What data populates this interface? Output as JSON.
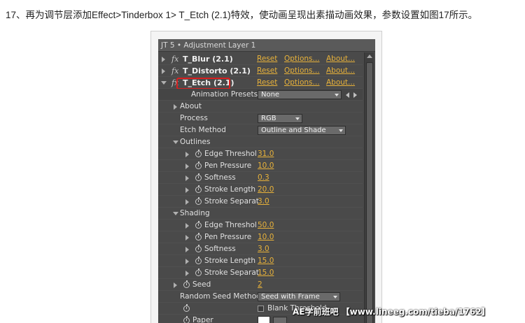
{
  "caption": "17、再为调节层添加Effect>Tinderbox 1> T_Etch (2.1)特效，使动画呈现出素描动画效果，参数设置如图17所示。",
  "panel": {
    "title": "JT 5 • Adjustment Layer 1",
    "fx_glyph": "fx",
    "effects": [
      {
        "name": "T_Blur (2.1)",
        "reset": "Reset",
        "options": "Options...",
        "about": "About..."
      },
      {
        "name": "T_Distorto (2.1)",
        "reset": "Reset",
        "options": "Options...",
        "about": "About..."
      },
      {
        "name": "T_Etch (2.1)",
        "reset": "Reset",
        "options": "Options...",
        "about": "About..."
      }
    ],
    "animation_presets_label": "Animation Presets:",
    "animation_presets_value": "None",
    "about_label": "About",
    "process_label": "Process",
    "process_value": "RGB",
    "etch_method_label": "Etch Method",
    "etch_method_value": "Outline and Shade",
    "outlines": {
      "label": "Outlines",
      "params": [
        {
          "label": "Edge Threshol",
          "value": "31.0"
        },
        {
          "label": "Pen Pressure",
          "value": "10.0"
        },
        {
          "label": "Softness",
          "value": "0.3"
        },
        {
          "label": "Stroke Length",
          "value": "20.0"
        },
        {
          "label": "Stroke Separat",
          "value": "3.0"
        }
      ]
    },
    "shading": {
      "label": "Shading",
      "params": [
        {
          "label": "Edge Threshol",
          "value": "50.0"
        },
        {
          "label": "Pen Pressure",
          "value": "10.0"
        },
        {
          "label": "Softness",
          "value": "3.0"
        },
        {
          "label": "Stroke Length",
          "value": "15.0"
        },
        {
          "label": "Stroke Separat",
          "value": "15.0"
        }
      ]
    },
    "seed_label": "Seed",
    "seed_value": "2",
    "random_seed_label": "Random Seed Method",
    "random_seed_value": "Seed with Frame",
    "blank_threshold_label": "Blank Threshold",
    "paper_label": "Paper"
  },
  "watermark": "AE学前班吧 【www.lineeg.com/tieba/1762】",
  "colors": {
    "panel_bg": "#4a4a4a",
    "link": "#e8b23a",
    "highlight": "#d92020"
  }
}
